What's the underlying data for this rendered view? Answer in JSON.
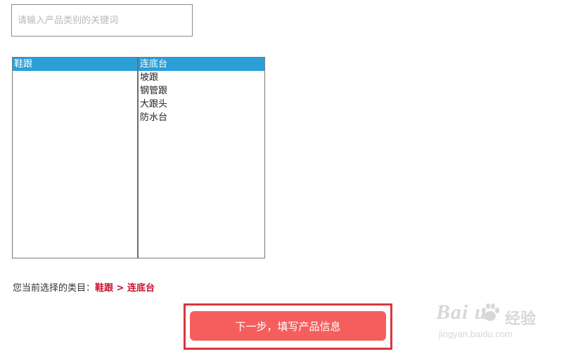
{
  "search": {
    "placeholder": "请输入产品类别的关键词",
    "value": ""
  },
  "categories": {
    "level1": [
      {
        "label": "鞋跟",
        "selected": true
      }
    ],
    "level2": [
      {
        "label": "连底台",
        "selected": true
      },
      {
        "label": "坡跟",
        "selected": false
      },
      {
        "label": "钢管跟",
        "selected": false
      },
      {
        "label": "大跟头",
        "selected": false
      },
      {
        "label": "防水台",
        "selected": false
      }
    ]
  },
  "selection": {
    "prefix": "您当前选择的类目：",
    "path": "鞋跟 > 连底台"
  },
  "next_button": {
    "label": "下一步，填写产品信息"
  },
  "watermark": {
    "logo": "Bai  u",
    "jingyan": "经验",
    "url": "jingyan.baidu.com"
  },
  "colors": {
    "selected_bg": "#2a9fd8",
    "button_bg": "#f65e5e",
    "highlight_frame": "#d9363e",
    "path_text": "#c8102e"
  }
}
